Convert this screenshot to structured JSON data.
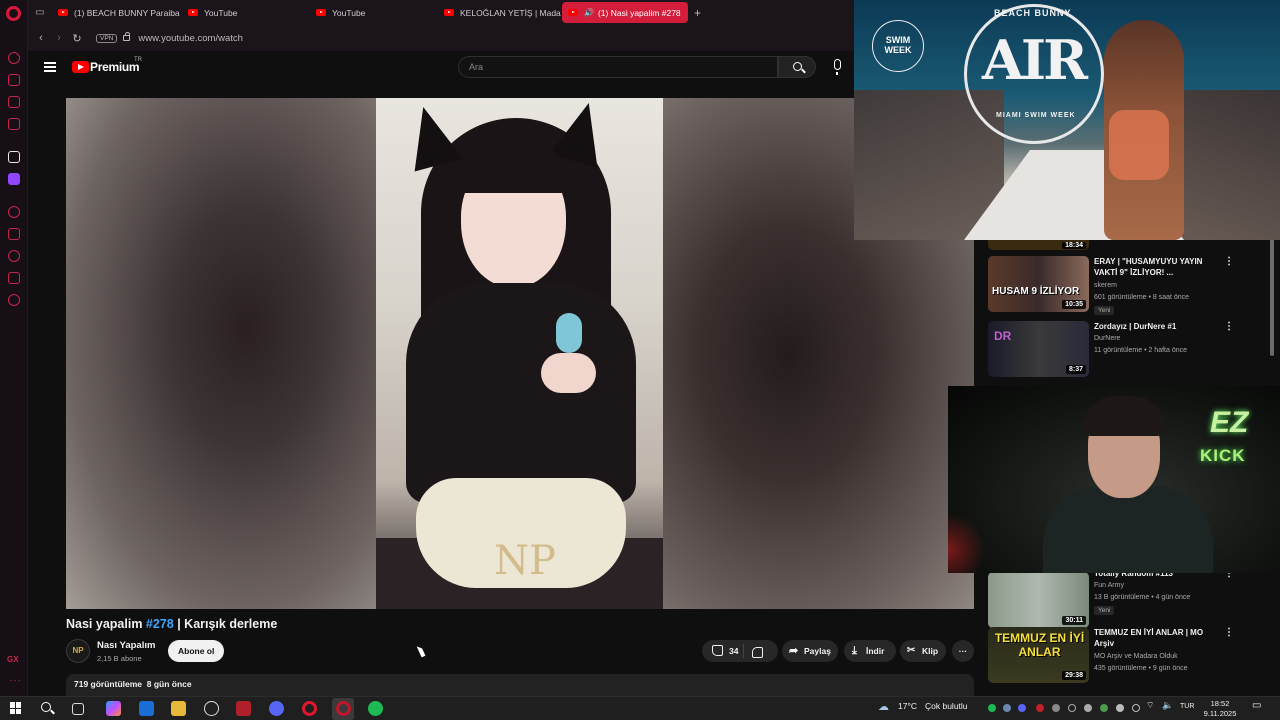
{
  "browser": {
    "tabs": [
      {
        "label": "(1) BEACH BUNNY Paraiba",
        "active": false
      },
      {
        "label": "YouTube",
        "active": false
      },
      {
        "label": "YouTube",
        "active": false
      },
      {
        "label": "KELOĞLAN YETİŞ | Mada",
        "active": false
      },
      {
        "label": "(1) Nasi yapalim #278",
        "active": true
      }
    ],
    "new_tab": "+",
    "vpn_label": "VPN",
    "url": "www.youtube.com/watch"
  },
  "youtube": {
    "brand": "Premium",
    "brand_region": "TR",
    "search_placeholder": "Ara"
  },
  "video": {
    "title_prefix": "Nasi yapalim ",
    "title_tag": "#278",
    "title_suffix": " | Karışık derleme",
    "watermark": "NP",
    "channel_avatar": "NP",
    "channel_name": "Nası Yapalım",
    "channel_subs": "2,15 B abone",
    "subscribe_label": "Abone ol",
    "likes": "34",
    "share_label": "Paylaş",
    "download_label": "İndir",
    "clip_label": "Klip",
    "more_label": "···",
    "desc_views": "719 görüntüleme",
    "desc_age": "8 gün önce"
  },
  "recommendations": [
    {
      "title": "ERAY | \"HUSAMYUYU YAYIN VAKTİ 9\" İZLİYOR! ...",
      "channel": "skerem",
      "meta": "601 görüntüleme • 8 saat önce",
      "badge": "Yeni",
      "duration": "10:35",
      "thumb_text": "HUSAM 9 İZLİYOR"
    },
    {
      "title": "Zordayız | DurNere #1",
      "channel": "DurNere",
      "meta": "11 görüntüleme • 2 hafta önce",
      "badge": "",
      "duration": "8:37",
      "thumb_text": "DR"
    },
    {
      "title": "Totally Random #113",
      "channel": "Fun Army",
      "meta": "13 B görüntüleme • 4 gün önce",
      "badge": "Yeni",
      "duration": "30:11",
      "thumb_text": ""
    },
    {
      "title": "TEMMUZ EN İYİ ANLAR | MO Arşiv",
      "channel": "MO Arşiv ve Madara Olduk",
      "meta": "435 görüntüleme • 9 gün önce",
      "badge": "",
      "duration": "29:38",
      "thumb_text": "TEMMUZ EN İYİ ANLAR"
    }
  ],
  "partial_top_duration": "18:34",
  "overlays": {
    "runway": {
      "logo_main": "AIR",
      "logo_top": "BEACH BUNNY",
      "logo_bottom": "MIAMI SWIM WEEK",
      "badge": "SWIM WEEK"
    },
    "webcam": {
      "sign1": "EZ",
      "sign2": "KICK"
    }
  },
  "rail": {
    "gx": "GX",
    "dots": "···"
  },
  "taskbar": {
    "weather_temp": "17°C",
    "weather_text": "Çok bulutlu",
    "lang": "TUR",
    "time": "18:52",
    "date": "9.11.2025"
  }
}
